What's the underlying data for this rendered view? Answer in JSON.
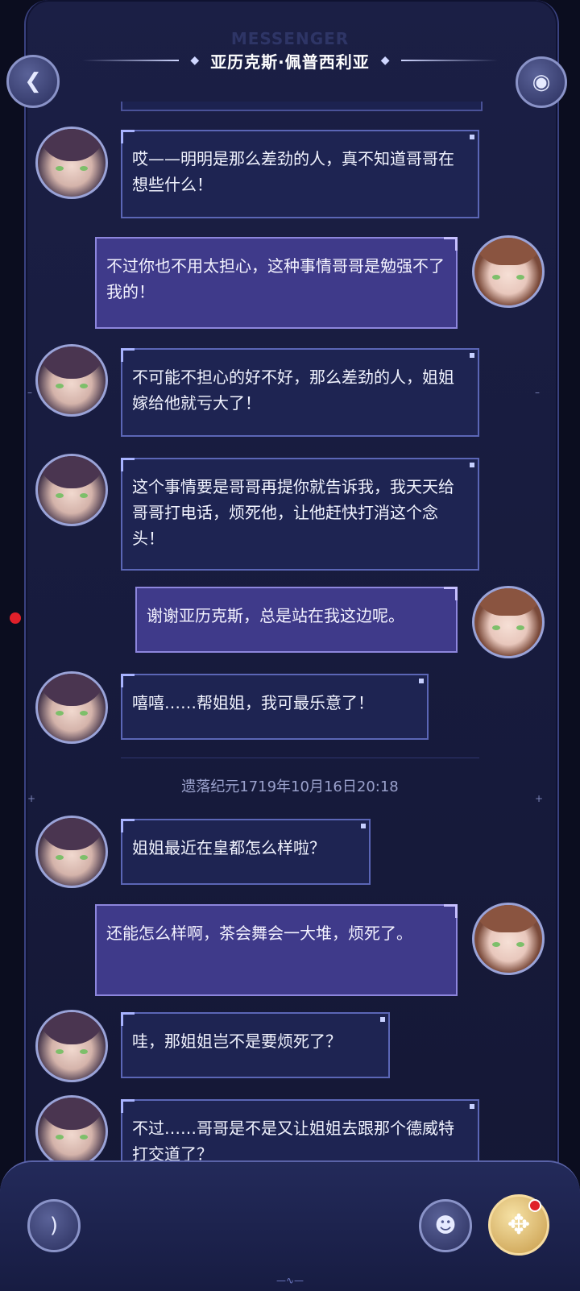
{
  "header": {
    "app_label": "MESSENGER",
    "contact_name": "亚历克斯·佩普西利亚"
  },
  "icons": {
    "back": "back-arrow-icon",
    "bot": "assistant-bot-icon",
    "voice": "voice-icon",
    "emoji": "emoji-icon",
    "move": "move-cross-icon"
  },
  "messages": [
    {
      "side": "left",
      "text": "哎——明明是那么差劲的人，真不知道哥哥在想些什么！"
    },
    {
      "side": "right",
      "text": "不过你也不用太担心，这种事情哥哥是勉强不了我的！"
    },
    {
      "side": "left",
      "text": "不可能不担心的好不好，那么差劲的人，姐姐嫁给他就亏大了！"
    },
    {
      "side": "left",
      "text": "这个事情要是哥哥再提你就告诉我，我天天给哥哥打电话，烦死他，让他赶快打消这个念头！"
    },
    {
      "side": "right",
      "text": "谢谢亚历克斯，总是站在我这边呢。"
    },
    {
      "side": "left",
      "text": "嘻嘻……帮姐姐，我可最乐意了！"
    },
    {
      "side": "left",
      "text": "姐姐最近在皇都怎么样啦？"
    },
    {
      "side": "right",
      "text": "还能怎么样啊，茶会舞会一大堆，烦死了。"
    },
    {
      "side": "left",
      "text": "哇，那姐姐岂不是要烦死了？"
    },
    {
      "side": "left",
      "text": "不过……哥哥是不是又让姐姐去跟那个德威特打交道了？"
    }
  ],
  "timestamp": "遗落纪元1719年10月16日20:18",
  "colors": {
    "bubble_left": "#1e2452",
    "bubble_right": "#3f3a8a",
    "accent": "#8a93c8",
    "notification": "#e0202a"
  }
}
